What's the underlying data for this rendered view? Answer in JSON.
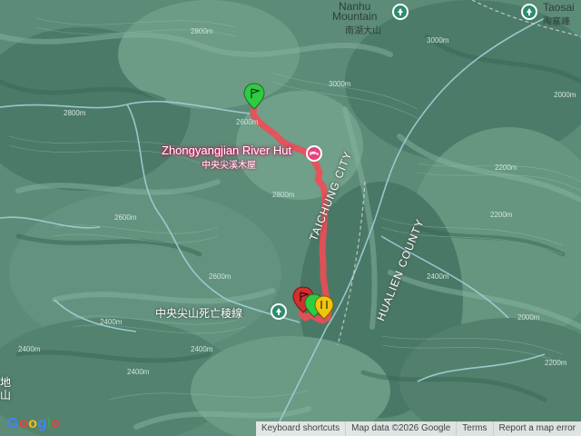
{
  "labels": {
    "nanhu_en": "Nanhu",
    "nanhu_en2": "Mountain",
    "nanhu_zh": "南湖大山",
    "taosai_en": "Taosai",
    "taosai_zh": "陶塞峰",
    "river_hut_en": "Zhongyangjian River Hut",
    "river_hut_zh": "中央尖溪木屋",
    "ridge_zh": "中央尖山死亡稜線",
    "taichung": "TAICHUNG CITY",
    "hualien": "HUALIEN COUNTY",
    "edge_zh": "地",
    "edge_zh2": "山"
  },
  "elevations": [
    "3000m",
    "2800m",
    "2600m",
    "2800m",
    "2400m",
    "2400m",
    "2600m",
    "2400m",
    "2200m",
    "2400m",
    "2200m",
    "2000m",
    "2200m",
    "2000m",
    "2600m",
    "2400m",
    "2800m",
    "3000m"
  ],
  "footer": {
    "shortcuts": "Keyboard shortcuts",
    "map_data": "Map data ©2026 Google",
    "terms": "Terms",
    "report": "Report a map error"
  },
  "google": [
    "G",
    "o",
    "o",
    "g",
    "l",
    "e"
  ],
  "colors": {
    "track": "#ef4b55",
    "marker_start": "#2ecc40",
    "marker_end": "#d32f2f",
    "marker_yellow": "#f1c40f",
    "terrain": "#5f8e7a",
    "rivers": "#9fd0d8"
  },
  "icons": [
    "park-icon",
    "lodging-icon",
    "start-marker-icon",
    "end-marker-icon",
    "waypoint-marker-icon"
  ]
}
